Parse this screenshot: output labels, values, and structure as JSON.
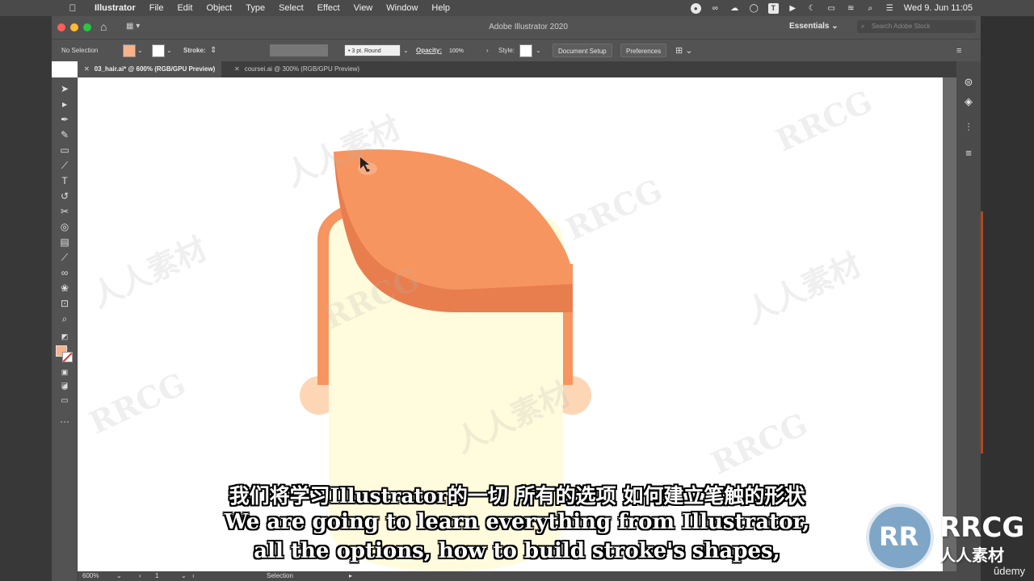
{
  "menubar": {
    "apple": "",
    "items": [
      "Illustrator",
      "File",
      "Edit",
      "Object",
      "Type",
      "Select",
      "Effect",
      "View",
      "Window",
      "Help"
    ],
    "status_icons": [
      "record-icon",
      "creative-cloud-icon",
      "cloud-upload-icon",
      "chat-icon",
      "text-t-icon",
      "play-icon",
      "moon-icon",
      "battery-icon",
      "wifi-icon",
      "search-icon",
      "control-center-icon"
    ],
    "clock": "Wed 9. Jun  11:05"
  },
  "titlebar": {
    "title": "Adobe Illustrator 2020",
    "workspace": "Essentials",
    "search_placeholder": "Search Adobe Stock"
  },
  "controlbar": {
    "selection": "No Selection",
    "fill_color": "#f7b289",
    "stroke_label": "Stroke:",
    "brush": "3 pt. Round",
    "opacity_label": "Opacity:",
    "opacity_value": "100%",
    "style_label": "Style:",
    "document_setup": "Document Setup",
    "preferences": "Preferences"
  },
  "tabs": [
    {
      "label": "03_hair.ai* @ 600% (RGB/GPU Preview)"
    },
    {
      "label": "coursei.ai @ 300% (RGB/GPU Preview)"
    }
  ],
  "toolbar_icons": [
    "selection-tool-icon",
    "direct-selection-tool-icon",
    "pen-tool-icon",
    "curvature-tool-icon",
    "rectangle-tool-icon",
    "paintbrush-tool-icon",
    "type-tool-icon",
    "rotate-tool-icon",
    "scissors-tool-icon",
    "shape-builder-tool-icon",
    "gradient-tool-icon",
    "eyedropper-tool-icon",
    "blend-tool-icon",
    "symbol-sprayer-tool-icon",
    "artboard-tool-icon",
    "zoom-tool-icon",
    "swap-fill-stroke-icon",
    "fill-stroke-swatch-icon",
    "color-mode-icon",
    "draw-mode-icon",
    "screen-mode-icon",
    "more-tools-icon"
  ],
  "dock_icons": [
    "properties-panel-icon",
    "layers-panel-icon",
    "align-panel-icon",
    "menu-panel-icon"
  ],
  "colors": {
    "hair": "#f6955f",
    "hair_shadow": "#e87d4e",
    "face": "#fffbdc",
    "ear": "#fdd6b5"
  },
  "statusbar": {
    "zoom": "600%",
    "artboard": "1",
    "tool": "Selection"
  },
  "watermark": {
    "latin": "RRCG",
    "cjk": "人人素材"
  },
  "subtitles": {
    "chinese": "我们将学习Illustrator的一切 所有的选项 如何建立笔触的形状",
    "english_line1": "We are going to learn everything from Illustrator,",
    "english_line2": "all the options, how to build stroke's shapes,"
  },
  "branding": {
    "logo_text": "RRCG",
    "logo_sub": "人人素材",
    "udemy": "ûdemy"
  }
}
